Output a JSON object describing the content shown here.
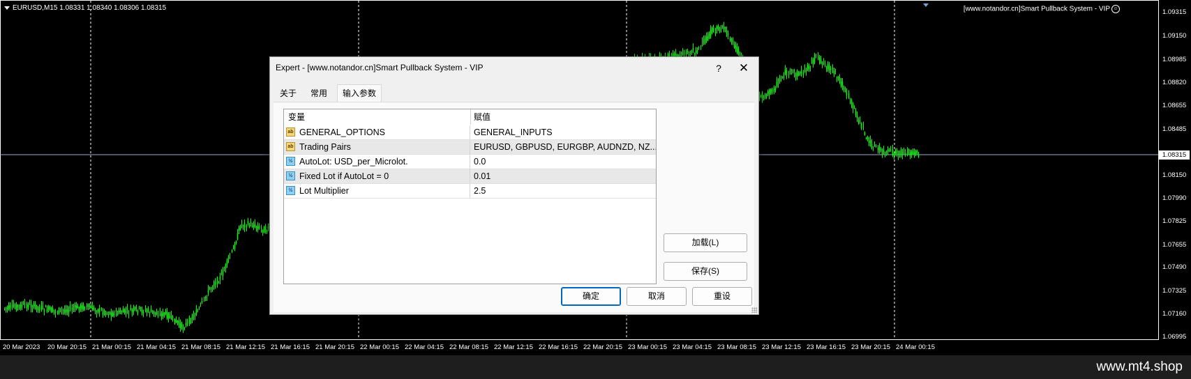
{
  "chart": {
    "symbol_info": "EURUSD,M15  1.08331 1.08340 1.08306 1.08315",
    "ea_label": "[www.notandor.cn]Smart Pullback System - VIP",
    "ea_icon": "smiley-icon",
    "current_price": "1.08315",
    "price_labels": [
      "1.09315",
      "1.09150",
      "1.08985",
      "1.08820",
      "1.08655",
      "1.08485",
      "1.08150",
      "1.07990",
      "1.07825",
      "1.07655",
      "1.07490",
      "1.07325",
      "1.07160",
      "1.06995"
    ],
    "time_labels": [
      "20 Mar 2023",
      "20 Mar 20:15",
      "21 Mar 00:15",
      "21 Mar 04:15",
      "21 Mar 08:15",
      "21 Mar 12:15",
      "21 Mar 16:15",
      "21 Mar 20:15",
      "22 Mar 00:15",
      "22 Mar 04:15",
      "22 Mar 08:15",
      "22 Mar 12:15",
      "22 Mar 16:15",
      "22 Mar 20:15",
      "23 Mar 00:15",
      "23 Mar 04:15",
      "23 Mar 08:15",
      "23 Mar 12:15",
      "23 Mar 16:15",
      "23 Mar 20:15",
      "24 Mar 00:15"
    ],
    "candle_color": "#00ff00",
    "background": "#000000"
  },
  "dialog": {
    "title": "Expert - [www.notandor.cn]Smart Pullback System - VIP",
    "help": "?",
    "close": "✕",
    "tabs": [
      {
        "label": "关于",
        "active": false
      },
      {
        "label": "常用",
        "active": false
      },
      {
        "label": "输入参数",
        "active": true
      }
    ],
    "grid": {
      "col_variable": "变量",
      "col_value": "赋值",
      "rows": [
        {
          "type": "ab",
          "icon": "string-type-icon",
          "name": "GENERAL_OPTIONS",
          "value": "GENERAL_INPUTS"
        },
        {
          "type": "ab",
          "icon": "string-type-icon",
          "name": "Trading Pairs",
          "value": "EURUSD, GBPUSD, EURGBP, AUDNZD, NZ..."
        },
        {
          "type": "½",
          "icon": "number-type-icon",
          "name": "AutoLot: USD_per_Microlot.",
          "value": "0.0"
        },
        {
          "type": "½",
          "icon": "number-type-icon",
          "name": "Fixed Lot if AutoLot = 0",
          "value": "0.01"
        },
        {
          "type": "½",
          "icon": "number-type-icon",
          "name": "Lot Multiplier",
          "value": "2.5"
        }
      ]
    },
    "buttons": {
      "load": "加载(L)",
      "save": "保存(S)",
      "ok": "确定",
      "cancel": "取消",
      "reset": "重设"
    }
  },
  "footer": {
    "watermark": "www.mt4.shop"
  }
}
